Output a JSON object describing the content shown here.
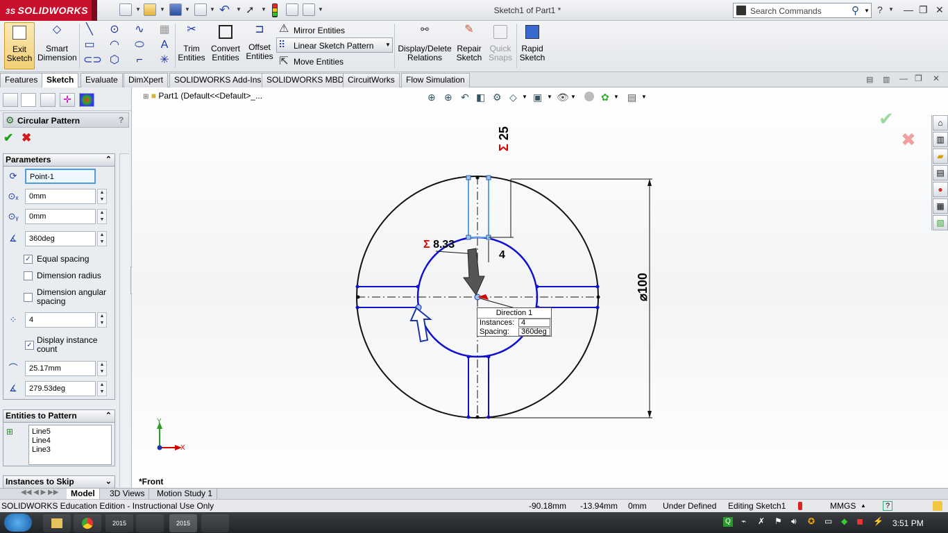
{
  "app": {
    "logo_prefix": "3S",
    "logo_text": "SOLIDWORKS",
    "title": "Sketch1 of Part1 *"
  },
  "search": {
    "placeholder": "Search Commands"
  },
  "command_manager": {
    "exit_sketch": "Exit\nSketch",
    "smart_dimension": "Smart\nDimension",
    "trim_entities": "Trim\nEntities",
    "convert_entities": "Convert\nEntities",
    "offset_entities": "Offset\nEntities",
    "mirror_entities": "Mirror Entities",
    "linear_sketch_pattern": "Linear Sketch Pattern",
    "move_entities": "Move Entities",
    "display_delete_relations": "Display/Delete\nRelations",
    "repair_sketch": "Repair\nSketch",
    "quick_snaps": "Quick\nSnaps",
    "rapid_sketch": "Rapid\nSketch"
  },
  "tabs": [
    "Features",
    "Sketch",
    "Evaluate",
    "DimXpert",
    "SOLIDWORKS Add-Ins",
    "SOLIDWORKS MBD",
    "CircuitWorks",
    "Flow Simulation"
  ],
  "active_tab": "Sketch",
  "property_manager": {
    "title": "Circular Pattern",
    "help": "?",
    "parameters": {
      "header": "Parameters",
      "center_point": "Point-1",
      "center_x": "0mm",
      "center_y": "0mm",
      "angle": "360deg",
      "equal_spacing": "Equal spacing",
      "dimension_radius": "Dimension radius",
      "dimension_angular_spacing": "Dimension angular spacing",
      "instances": "4",
      "display_instance_count": "Display instance count",
      "radius": "25.17mm",
      "arc_angle": "279.53deg",
      "equal_spacing_checked": true,
      "dimension_radius_checked": false,
      "dimension_angular_spacing_checked": false,
      "display_instance_count_checked": true
    },
    "entities_to_pattern": {
      "header": "Entities to Pattern",
      "items": [
        "Line5",
        "Line4",
        "Line3"
      ]
    },
    "instances_to_skip": {
      "header": "Instances to Skip"
    }
  },
  "feature_tree_flyout": "Part1  (Default<<Default>_...",
  "canvas": {
    "dim_top": "25",
    "dim_sigma": "Σ",
    "dim_left": "8.33",
    "dim_width": "4",
    "dim_diameter": "100",
    "callout_title": "Direction 1",
    "callout_instances_label": "Instances:",
    "callout_instances_value": "4",
    "callout_spacing_label": "Spacing:",
    "callout_spacing_value": "360deg",
    "view_label": "*Front",
    "axis_y": "Y",
    "axis_x": "X"
  },
  "bottom_tabs": [
    "Model",
    "3D Views",
    "Motion Study 1"
  ],
  "status": {
    "edition": "SOLIDWORKS Education Edition - Instructional Use Only",
    "x": "-90.18mm",
    "y": "-13.94mm",
    "z": "0mm",
    "state": "Under Defined",
    "editing": "Editing Sketch1",
    "units": "MMGS",
    "help": "?"
  },
  "taskbar": {
    "clock": "3:51 PM",
    "year_badge": "2015"
  },
  "colors": {
    "sketch_blue": "#1010d0",
    "selection_blue": "#5aa0e6",
    "brand_red": "#c8102e",
    "dim_red": "#d40000"
  }
}
